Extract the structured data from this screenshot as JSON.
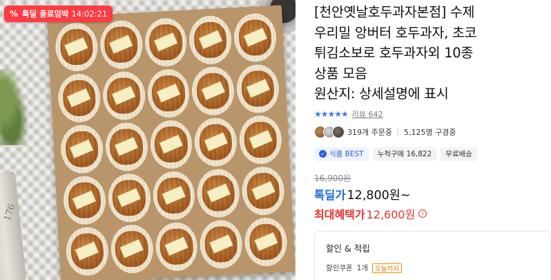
{
  "deal_badge": {
    "icon": "percent-icon",
    "label": "톡딜 종료임박",
    "timer": "14:02:21",
    "color": "#ff3b43"
  },
  "product": {
    "title": "[천안옛날호두과자본점] 수제 우리밀 앙버터 호두과자, 초코튀김소보로 호두과자외 10종 상품 모음\n원산지: 상세설명에 표시",
    "title_lines": [
      "[천안옛날호두과자본점] 수제",
      "우리밀 앙버터 호두과자, 초코",
      "튀김소보로 호두과자외 10종",
      "상품 모음",
      "원산지: 상세설명에 표시"
    ],
    "image_jar_text": "176"
  },
  "rating": {
    "stars": "★★★★★",
    "star_count": 5,
    "review_label": "리뷰",
    "review_count": "642",
    "accent": "#3a76f0"
  },
  "buyers": {
    "orders": "319개 주문중",
    "considering": "5,125명 구경중"
  },
  "tags": {
    "best": "식품 BEST",
    "cumulative": "누적구매 16,822",
    "shipping": "무료배송"
  },
  "price": {
    "original": "16,900원",
    "deal_label": "톡딜가",
    "deal_value": "12,800원~",
    "max_label": "최대혜택가",
    "max_value": "12,600원",
    "deal_color": "#1a6bd9",
    "max_color": "#e8312f"
  },
  "benefits": {
    "title": "할인 & 적립",
    "coupon_label": "할인쿠폰",
    "coupon_count": "1개",
    "until_badge": "오늘까지"
  }
}
